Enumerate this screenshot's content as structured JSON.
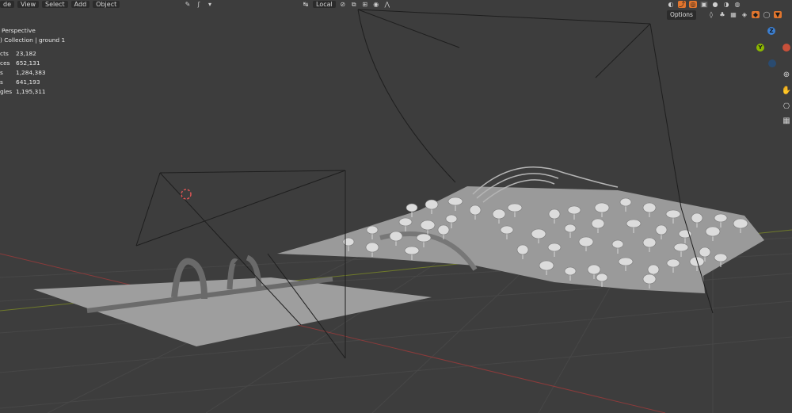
{
  "header": {
    "mode_partial": "de",
    "menus": [
      "View",
      "Select",
      "Add",
      "Object"
    ],
    "transform_orientation": "Local",
    "options_label": "Options"
  },
  "overlay": {
    "view_label": "Perspective",
    "collection_line": ") Collection | ground 1",
    "stats": [
      {
        "label": "cts",
        "value": "23,182"
      },
      {
        "label": "ces",
        "value": "652,131"
      },
      {
        "label": "s",
        "value": "1,284,383"
      },
      {
        "label": "s",
        "value": "641,193"
      },
      {
        "label": "gles",
        "value": "1,195,311"
      }
    ]
  },
  "gizmo": {
    "z_label": "Z",
    "y_label": "Y",
    "x_color": "#c8503a",
    "y_color": "#8cb800",
    "z_color": "#3c7fd1"
  },
  "colors": {
    "viewport_bg": "#3d3d3d",
    "grid": "#474747",
    "x_axis": "#8a3b3b",
    "y_axis": "#6f7a2a",
    "accent": "#e0752e"
  },
  "icons": [
    "hand-icon",
    "camera-icon",
    "grid-icon",
    "zoom-icon",
    "cursor-icon"
  ]
}
